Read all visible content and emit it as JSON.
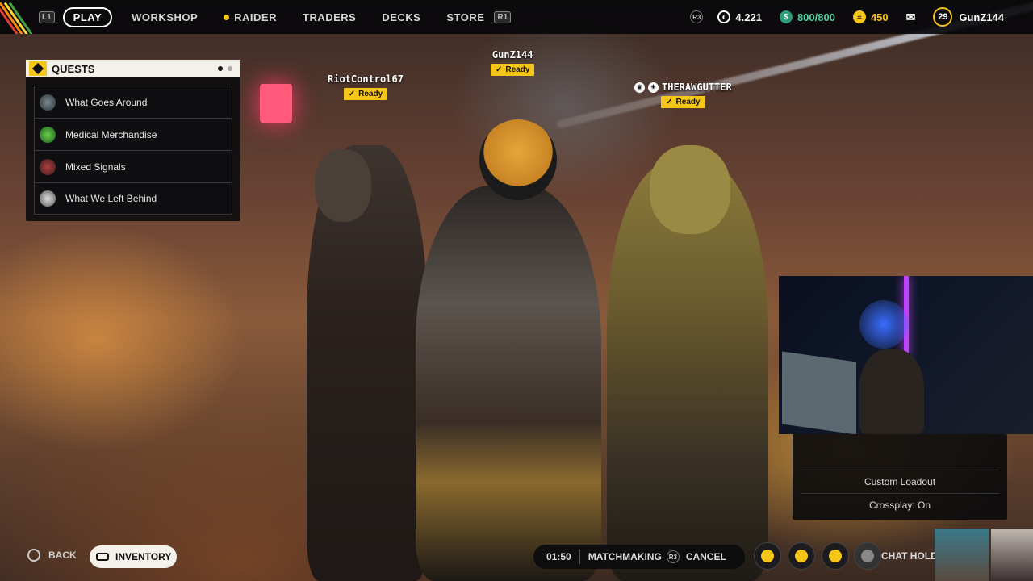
{
  "nav": {
    "l1": "L1",
    "r1": "R1",
    "items": [
      "PLAY",
      "WORKSHOP",
      "RAIDER",
      "TRADERS",
      "DECKS",
      "STORE"
    ]
  },
  "currencies": {
    "r3": "R3",
    "coins": "4.221",
    "seeds": "800/800",
    "raider_tokens": "450"
  },
  "player": {
    "level": "29",
    "name": "GunZ144"
  },
  "squad": [
    {
      "name": "RiotControl67",
      "status": "Ready"
    },
    {
      "name": "GunZ144",
      "status": "Ready"
    },
    {
      "name": "THERAWGUTTER",
      "status": "Ready"
    }
  ],
  "quests": {
    "title": "QUESTS",
    "items": [
      {
        "label": "What Goes Around",
        "icon": "quest-avatar-icon"
      },
      {
        "label": "Medical Merchandise",
        "icon": "quest-avatar-icon"
      },
      {
        "label": "Mixed Signals",
        "icon": "quest-avatar-icon"
      },
      {
        "label": "What We Left Behind",
        "icon": "quest-avatar-icon"
      }
    ]
  },
  "loadout": {
    "custom": "Custom Loadout",
    "crossplay": "Crossplay: On"
  },
  "bottom": {
    "back": "BACK",
    "inventory": "INVENTORY",
    "timer": "01:50",
    "matchmaking": "MATCHMAKING",
    "r3": "R3",
    "cancel": "CANCEL",
    "chat": "CHAT HOLD"
  },
  "colors": {
    "accent": "#f5c518",
    "panel": "#0a0a0c",
    "header": "#f3f1ea"
  }
}
